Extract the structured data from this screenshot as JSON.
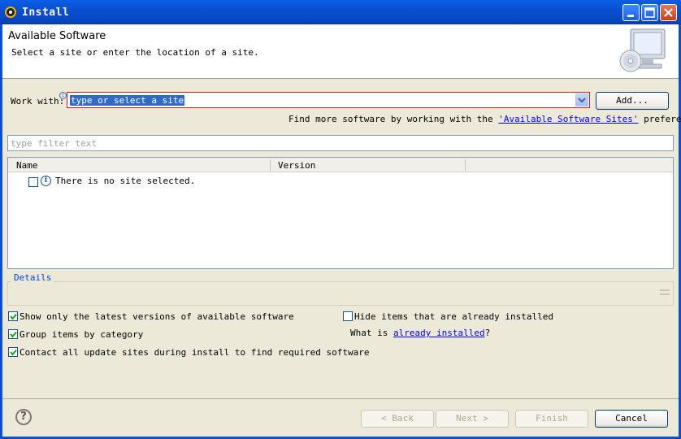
{
  "window": {
    "title": "Install",
    "controls": [
      "minimize-icon",
      "maximize-icon",
      "close-icon"
    ]
  },
  "header": {
    "title": "Available Software",
    "subtitle": "Select a site or enter the location of a site.",
    "banner_icon": "install-cd-computer-icon"
  },
  "work_with": {
    "label": "Work with:",
    "value": "type or select a site",
    "add_button": "Add...",
    "more_text": "Find more software by working with the",
    "more_link": "'Available Software Sites'",
    "more_suffix": "preferences."
  },
  "filter": {
    "placeholder": "type filter text"
  },
  "table": {
    "columns": [
      "Name",
      "Version"
    ],
    "rows": [
      {
        "checked": false,
        "icon": "info-icon",
        "text": "There is no site selected."
      }
    ]
  },
  "details": {
    "label": "Details"
  },
  "options": {
    "show_latest": {
      "label": "Show only the latest versions of available software",
      "checked": true
    },
    "group_by_category": {
      "label": "Group items by category",
      "checked": true
    },
    "contact_all": {
      "label": "Contact all update sites during install to find required software",
      "checked": true
    },
    "hide_installed": {
      "label": "Hide items that are already installed",
      "checked": false
    },
    "what_is_prefix": "What is",
    "what_is_link": "already installed",
    "what_is_suffix": "?"
  },
  "footer": {
    "help": "?",
    "back": "< Back",
    "next": "Next >",
    "finish": "Finish",
    "cancel": "Cancel"
  },
  "colors": {
    "titlebar": "#0a4fd0",
    "window_bg": "#ece9d8",
    "selection": "#316ac5",
    "link": "#0000ee",
    "invalid_border": "#d21e1e"
  }
}
